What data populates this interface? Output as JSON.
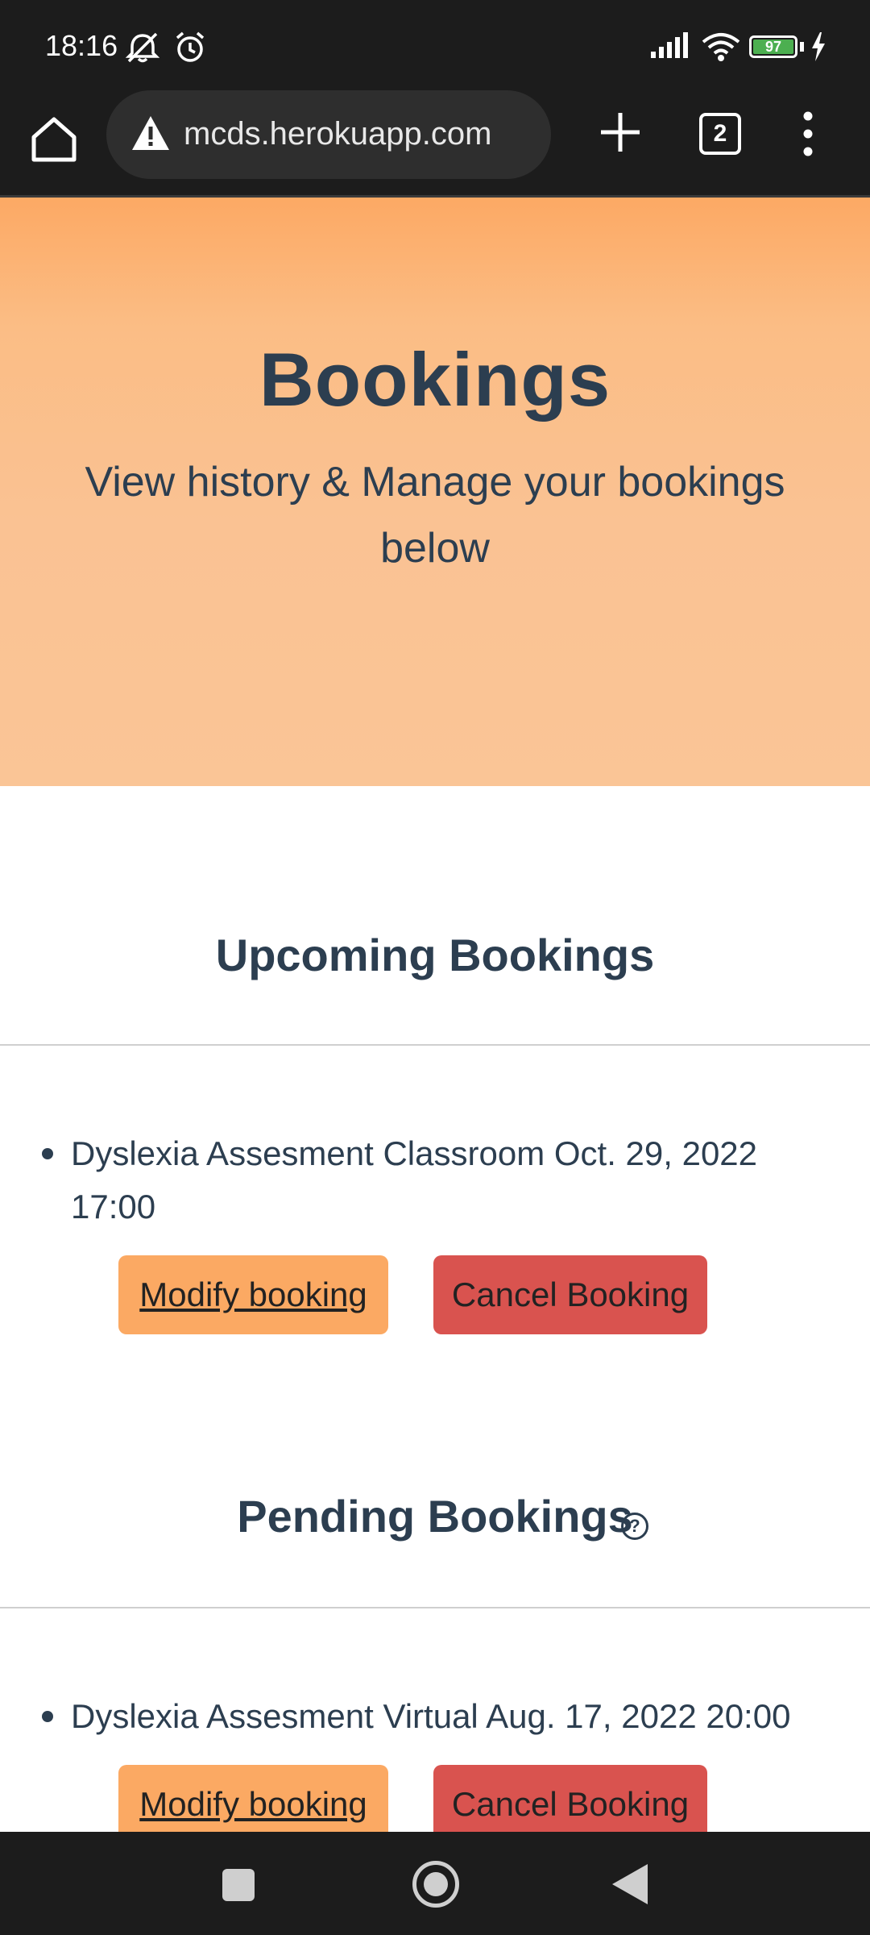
{
  "status_bar": {
    "time": "18:16",
    "battery": "97",
    "icons": [
      "mute-icon",
      "alarm-icon",
      "signal-icon",
      "wifi-icon",
      "battery-icon",
      "charging-icon"
    ]
  },
  "browser": {
    "url": "mcds.herokuapp.com",
    "tab_count": "2",
    "icons": [
      "home-icon",
      "warning-icon",
      "plus-icon",
      "tabs-icon",
      "menu-icon"
    ]
  },
  "hero": {
    "title": "Bookings",
    "subtitle": "View history & Manage your bookings below"
  },
  "upcoming": {
    "title": "Upcoming Bookings",
    "items": [
      {
        "text": "Dyslexia Assesment Classroom Oct. 29, 2022 17:00",
        "modify_label": "Modify booking",
        "cancel_label": "Cancel Booking"
      }
    ]
  },
  "pending": {
    "title": "Pending Bookings",
    "help_symbol": "?",
    "items": [
      {
        "text": "Dyslexia Assesment Virtual Aug. 17, 2022 20:00",
        "modify_label": "Modify booking",
        "cancel_label": "Cancel Booking"
      }
    ]
  },
  "colors": {
    "hero_gradient_top": "#fca964",
    "hero_gradient_bottom": "#fac596",
    "text": "#2c3e50",
    "modify_button": "#fba963",
    "cancel_button": "#d9534f"
  }
}
